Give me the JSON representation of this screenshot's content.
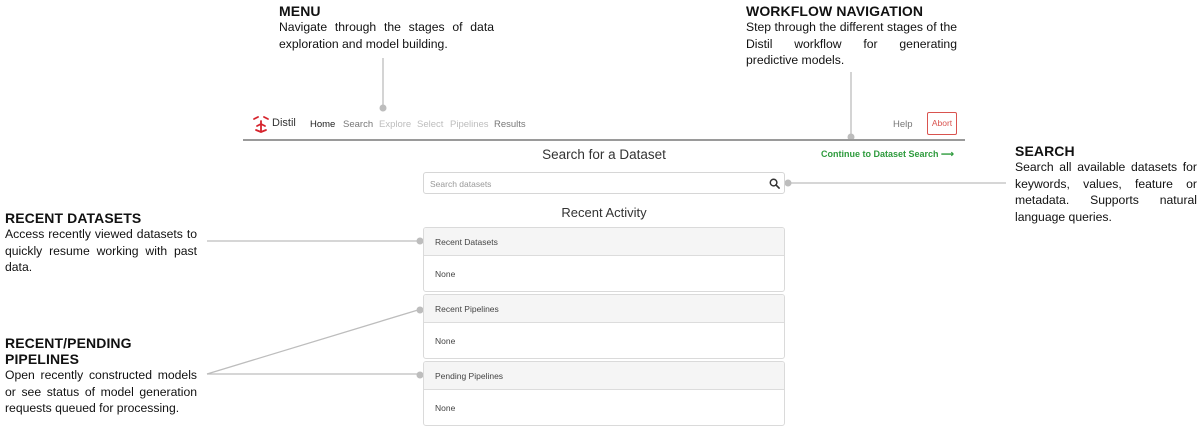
{
  "callouts": {
    "menu": {
      "title": "MENU",
      "body": "Navigate through the stages of data exploration and model building."
    },
    "workflow": {
      "title": "WORKFLOW NAVIGATION",
      "body": "Step through the different stages of the Distil workflow for generating predictive models."
    },
    "search": {
      "title": "SEARCH",
      "body": "Search all available datasets for keywords, values, feature or metadata. Supports natural language queries."
    },
    "recent_datasets": {
      "title": "RECENT DATASETS",
      "body": "Access recently viewed datasets to quickly resume working with past data."
    },
    "recent_pipelines": {
      "title": "RECENT/PENDING PIPELINES",
      "body": "Open recently constructed models or see status of model generation requests queued for processing."
    }
  },
  "app": {
    "brand": "Distil",
    "nav": [
      "Home",
      "Search",
      "Explore",
      "Select",
      "Pipelines",
      "Results"
    ],
    "help": "Help",
    "abort": "Abort",
    "continue_link": "Continue to Dataset Search ⟶",
    "page_title": "Search for a Dataset",
    "search_placeholder": "Search datasets",
    "recent_activity_title": "Recent Activity",
    "panels": [
      {
        "title": "Recent Datasets",
        "body": "None"
      },
      {
        "title": "Recent Pipelines",
        "body": "None"
      },
      {
        "title": "Pending Pipelines",
        "body": "None"
      }
    ]
  },
  "colors": {
    "accent_green": "#2e9b3d",
    "abort_red": "#d9534f",
    "logo_red": "#d6232c",
    "leader_gray": "#bdbdbd"
  },
  "icons": {
    "logo": "distil-logo",
    "search": "search-icon"
  }
}
